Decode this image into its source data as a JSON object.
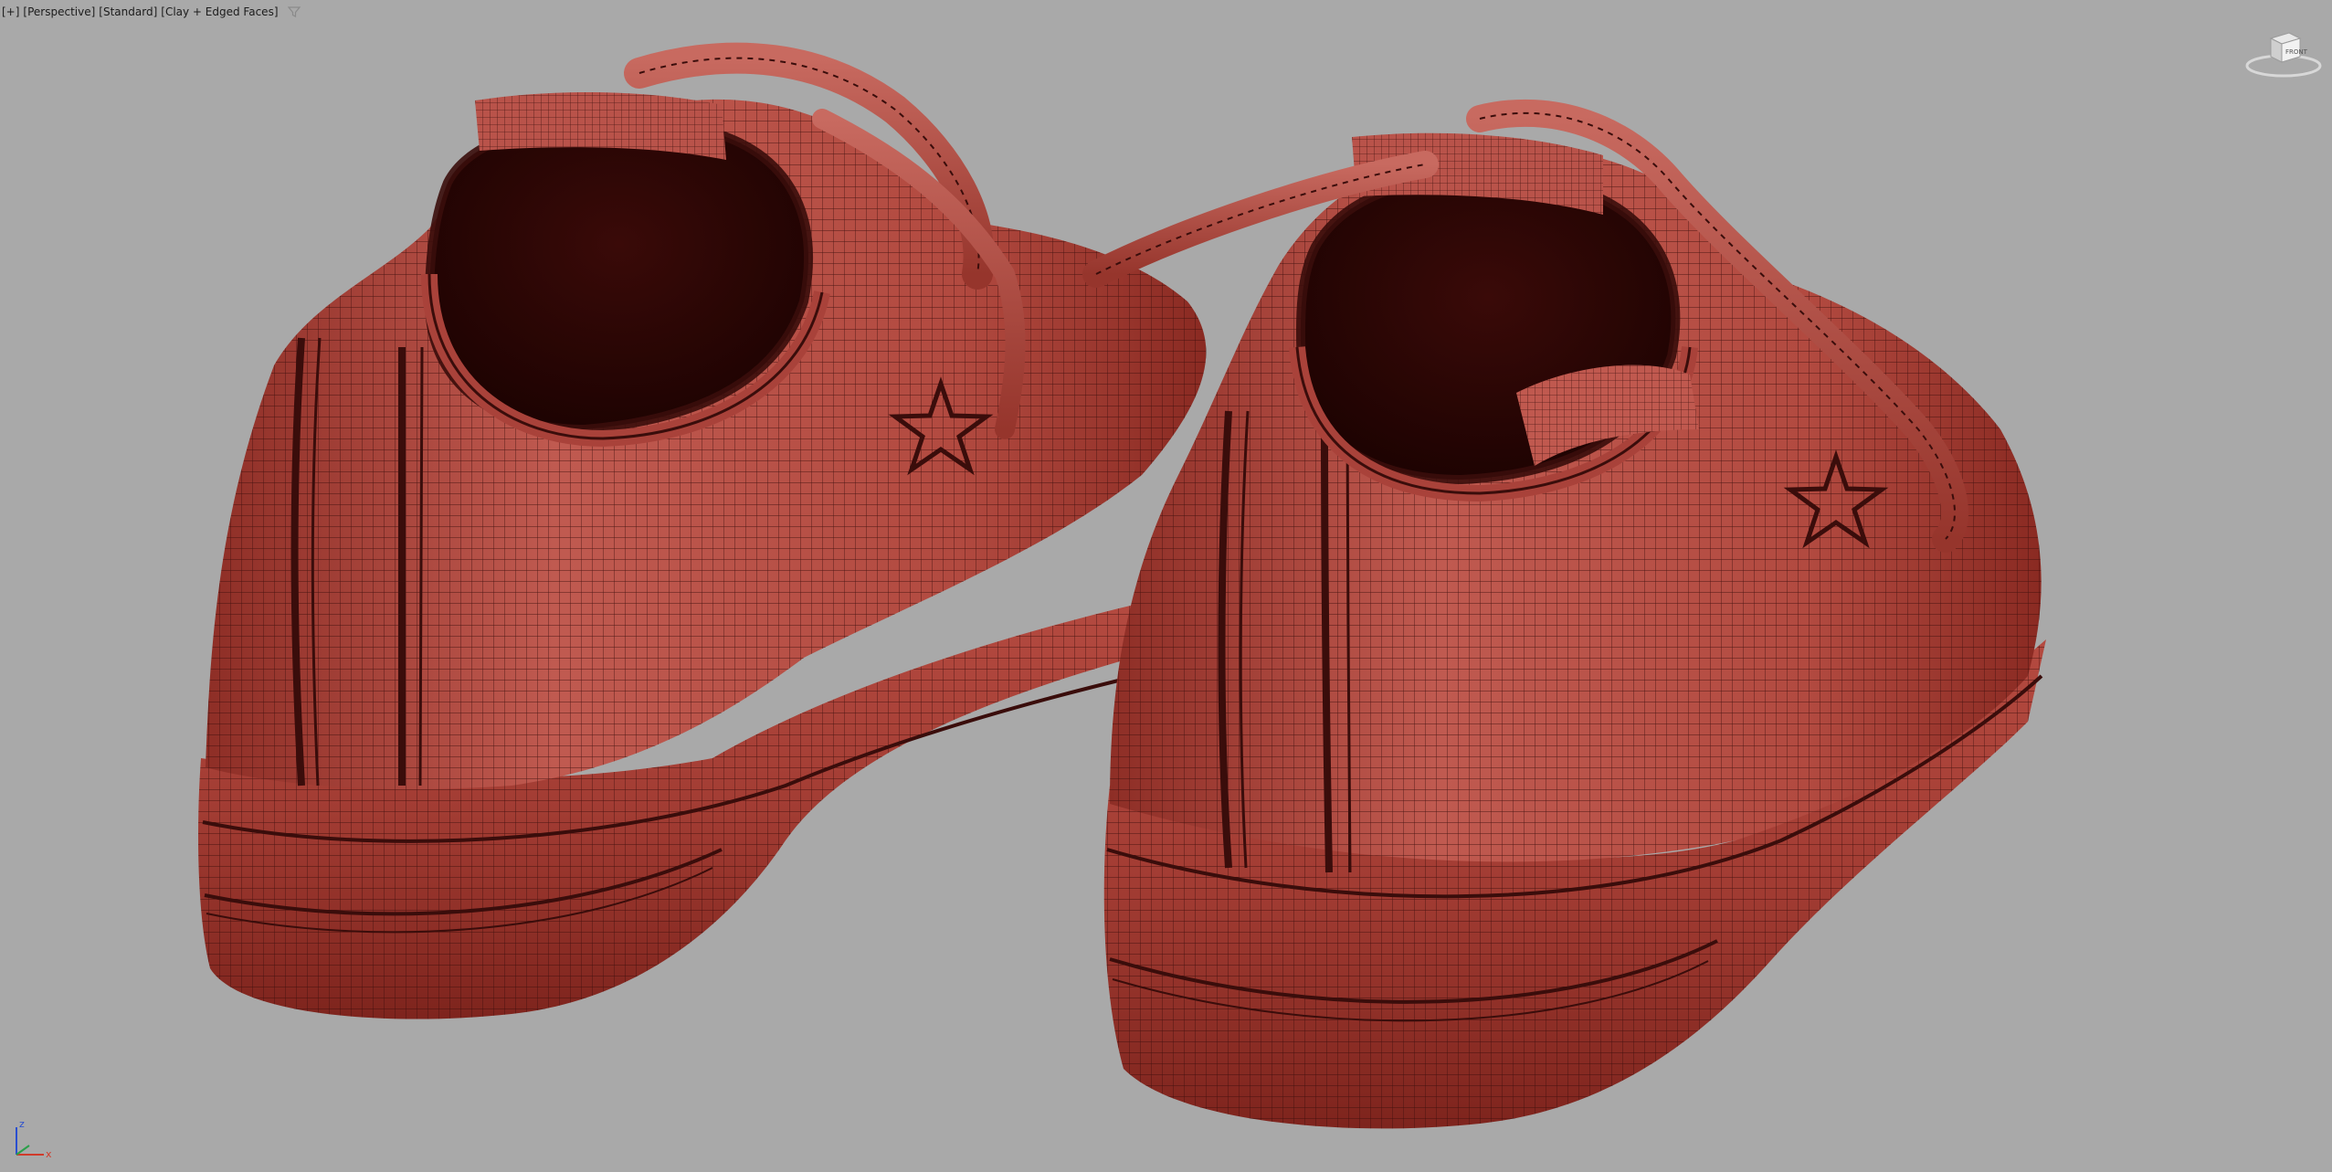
{
  "viewport": {
    "menu": {
      "plus_label": "[+]",
      "view_label": "[Perspective]",
      "shading_label": "[Standard]",
      "render_label": "[Clay + Edged Faces]"
    },
    "background_color": "#a9a9a9",
    "model_color": "#b8473e",
    "wire_color": "#3a0d0b",
    "interior_color": "#2a0606"
  },
  "viewcube": {
    "face_label": "FRONT"
  },
  "axis_tripod": {
    "z_label": "z",
    "x_label": "x",
    "z_color": "#2a4fd0",
    "x_color": "#d03a2a",
    "y_color": "#2aa04a"
  },
  "icons": {
    "filter": "filter-icon",
    "viewcube": "viewcube-icon",
    "axis": "axis-tripod-icon"
  }
}
